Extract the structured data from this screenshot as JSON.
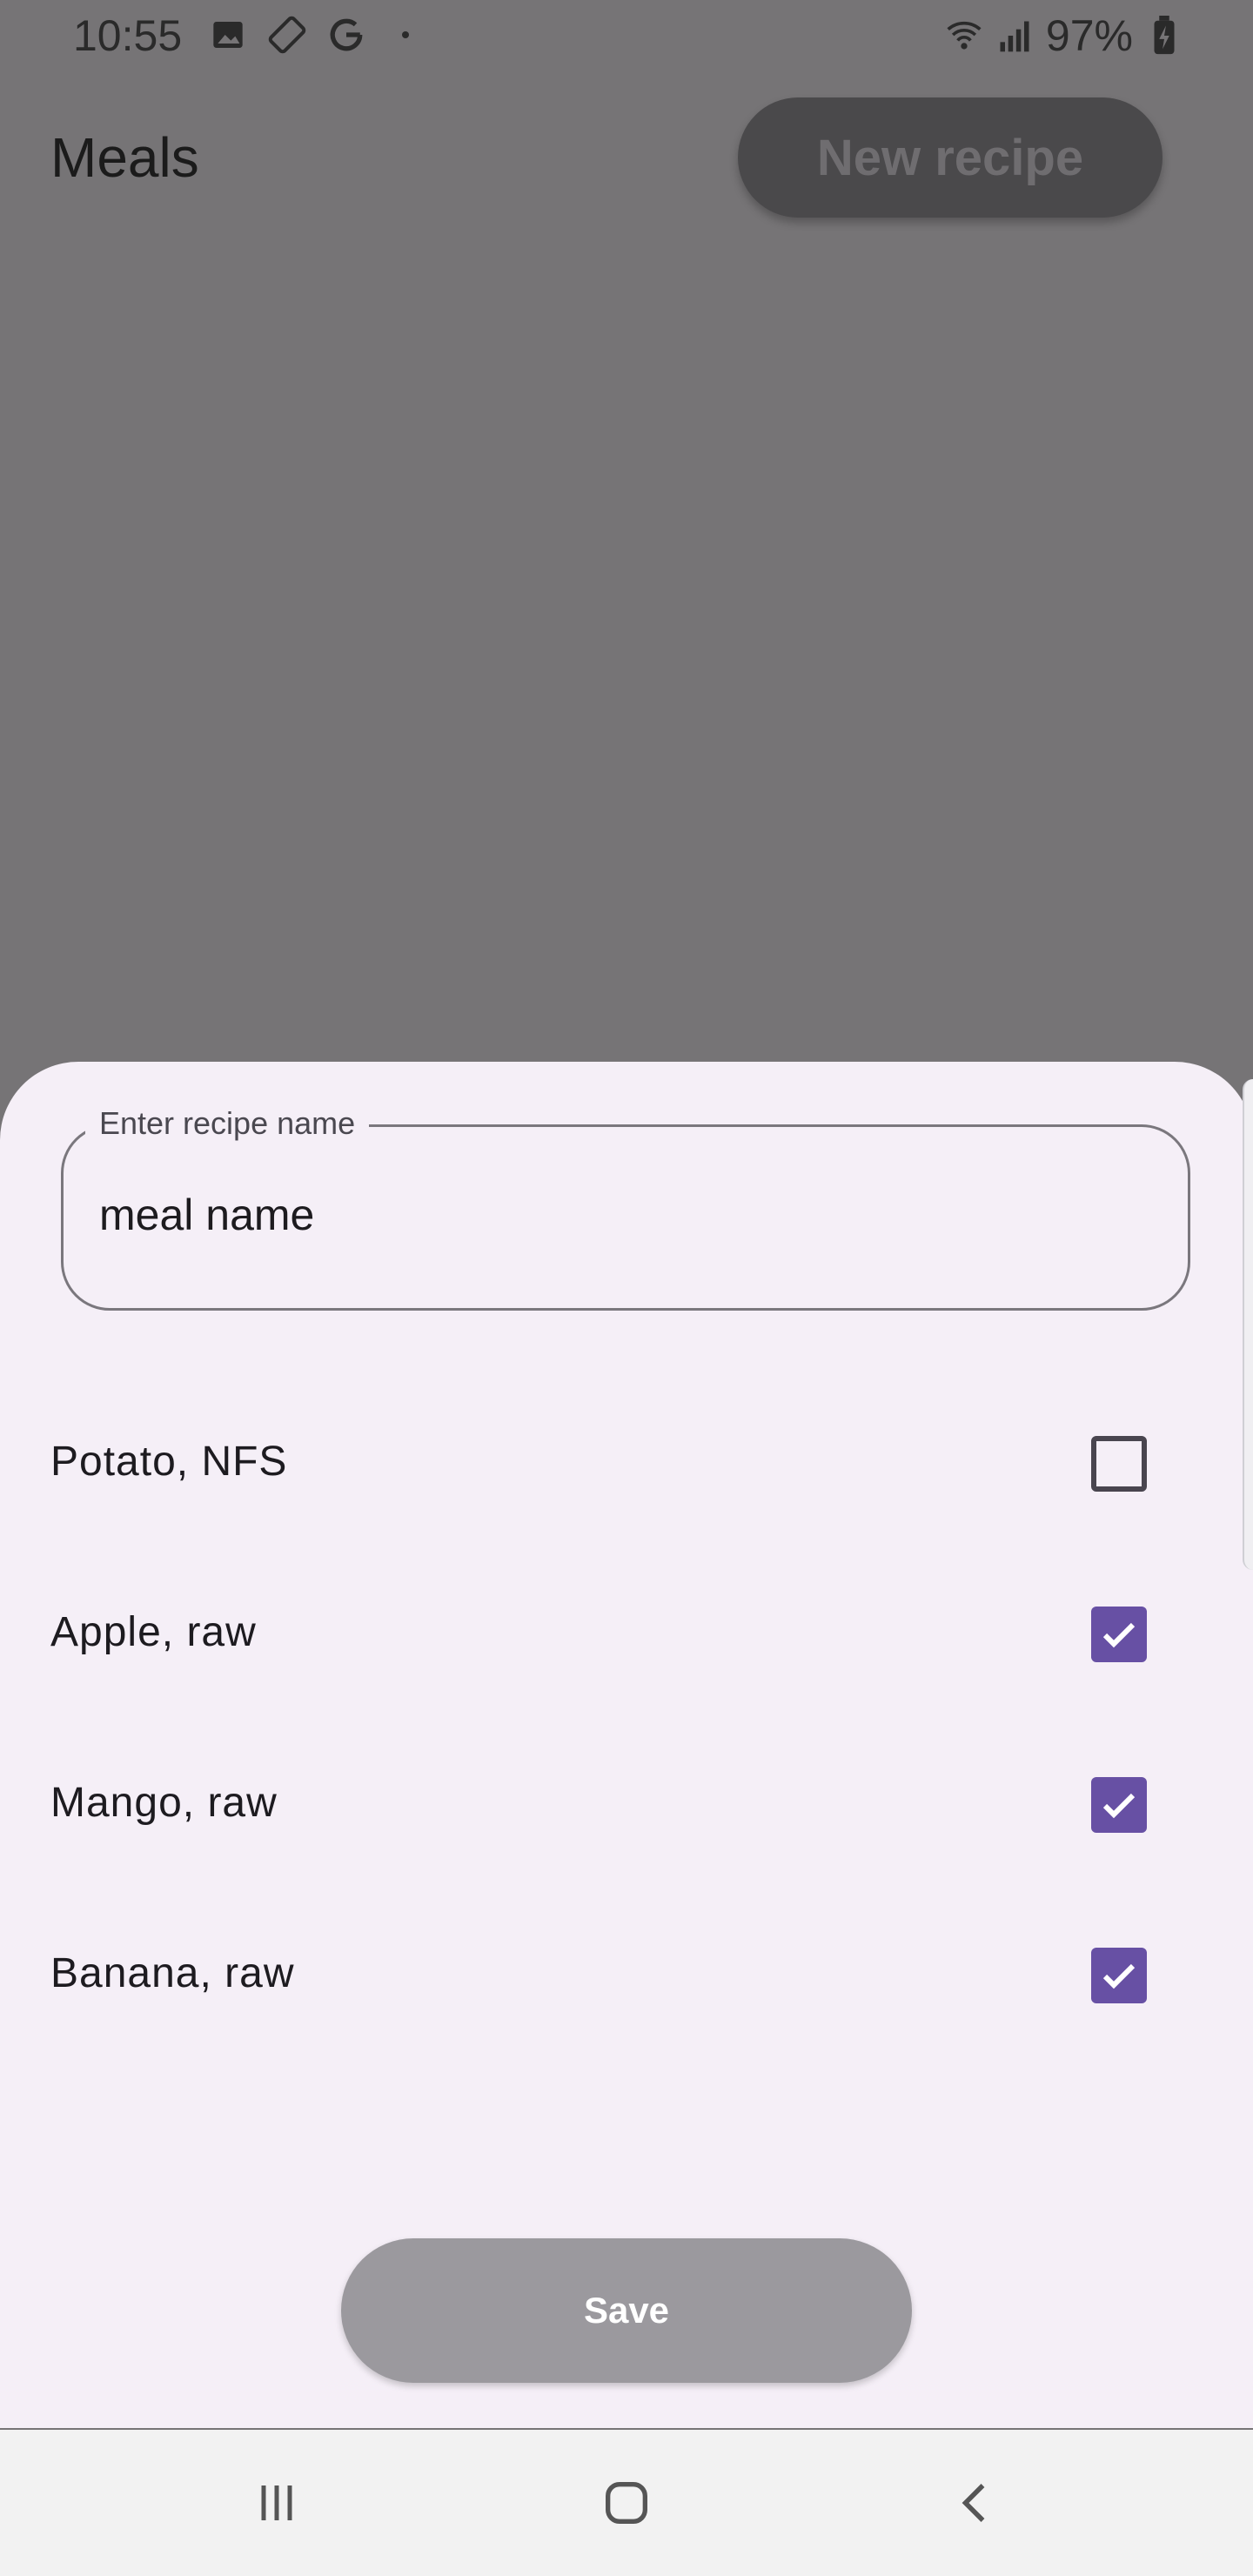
{
  "status_bar": {
    "time": "10:55",
    "left_icons": [
      "image-icon",
      "screen-rotation-icon",
      "google-icon",
      "dot-icon"
    ],
    "battery_percent": "97%",
    "right_icons": [
      "wifi-icon",
      "signal-icon",
      "battery-charging-icon"
    ]
  },
  "app_bar": {
    "title": "Meals",
    "new_recipe_label": "New recipe"
  },
  "sheet": {
    "recipe_field": {
      "label": "Enter recipe name",
      "value": "meal name"
    },
    "ingredients": [
      {
        "label": "Potato, NFS",
        "checked": false
      },
      {
        "label": "Apple, raw",
        "checked": true
      },
      {
        "label": "Mango, raw",
        "checked": true
      },
      {
        "label": "Banana, raw",
        "checked": true
      }
    ],
    "save_label": "Save"
  },
  "nav_bar": {
    "icons": [
      "recent-apps-icon",
      "home-icon",
      "back-icon"
    ]
  },
  "colors": {
    "accent": "#6750a4",
    "sheet_bg": "#f5eff7",
    "scrim": "#767476"
  }
}
